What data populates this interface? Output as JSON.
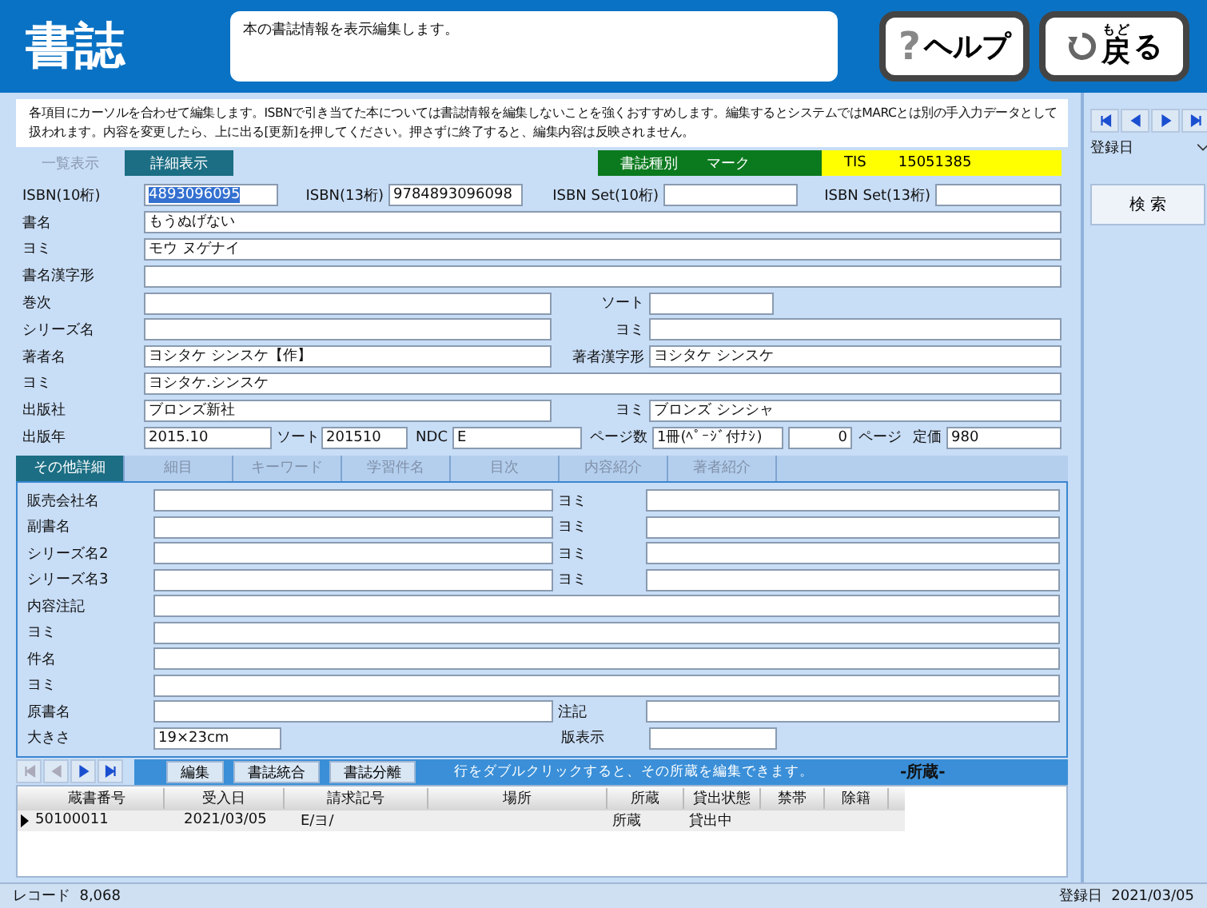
{
  "header": {
    "title": "書誌",
    "message": "本の書誌情報を表示編集します。",
    "help": {
      "icon": "?",
      "label": "ヘルプ"
    },
    "back": {
      "ruby_base": "戻",
      "ruby": "もど",
      "rest": "る"
    }
  },
  "notice": [
    "各項目にカーソルを合わせて編集します。ISBNで引き当てた本については書誌情報を編集しないことを強くおすすめします。編集するとシステムではMARCとは別の手入力データとして",
    "扱われます。内容を変更したら、上に出る[更新]を押してください。押さずに終了すると、編集内容は反映されません。"
  ],
  "view_tabs": [
    {
      "label": "一覧表示",
      "selected": false
    },
    {
      "label": "詳細表示",
      "selected": true
    }
  ],
  "badges": [
    {
      "label": "書誌種別",
      "value": "マーク",
      "color": "#0b7a1e"
    },
    {
      "label": "TIS",
      "value": "15051385",
      "color": "#ffff00"
    }
  ],
  "main_rows": [
    {
      "kind": "isbn",
      "items": [
        {
          "kind": "label",
          "text": "ISBN(10桁)"
        },
        {
          "kind": "field",
          "value": "4893096095",
          "text_selected": true
        },
        {
          "kind": "label",
          "text": "ISBN(13桁)"
        },
        {
          "kind": "field",
          "value": "9784893096098"
        },
        {
          "kind": "label",
          "text": "ISBN Set(10桁)"
        },
        {
          "kind": "field"
        },
        {
          "kind": "label",
          "text": "ISBN Set(13桁)"
        },
        {
          "kind": "field"
        }
      ]
    },
    {
      "kind": "full",
      "items": [
        {
          "kind": "label",
          "text": "書名"
        },
        {
          "kind": "field",
          "value": "もうぬげない"
        }
      ]
    },
    {
      "kind": "full",
      "items": [
        {
          "kind": "label",
          "text": "ヨミ"
        },
        {
          "kind": "field",
          "value": "モウ ヌゲナイ"
        }
      ]
    },
    {
      "kind": "full",
      "items": [
        {
          "kind": "label",
          "text": "書名漢字形"
        },
        {
          "kind": "field"
        }
      ]
    },
    {
      "kind": "splitshort",
      "items": [
        {
          "kind": "label",
          "text": "巻次"
        },
        {
          "kind": "field"
        },
        {
          "kind": "label",
          "text": "ソート"
        },
        {
          "kind": "field"
        }
      ]
    },
    {
      "kind": "split",
      "items": [
        {
          "kind": "label",
          "text": "シリーズ名"
        },
        {
          "kind": "field"
        },
        {
          "kind": "label",
          "text": "ヨミ"
        },
        {
          "kind": "field"
        }
      ]
    },
    {
      "kind": "split",
      "items": [
        {
          "kind": "label",
          "text": "著者名"
        },
        {
          "kind": "field",
          "value": "ヨシタケ シンスケ【作】"
        },
        {
          "kind": "label",
          "text": "著者漢字形"
        },
        {
          "kind": "field",
          "value": "ヨシタケ シンスケ"
        }
      ]
    },
    {
      "kind": "full",
      "items": [
        {
          "kind": "label",
          "text": "ヨミ"
        },
        {
          "kind": "field",
          "value": "ヨシタケ.シンスケ"
        }
      ]
    },
    {
      "kind": "split",
      "items": [
        {
          "kind": "label",
          "text": "出版社"
        },
        {
          "kind": "field",
          "value": "ブロンズ新社"
        },
        {
          "kind": "label",
          "text": "ヨミ"
        },
        {
          "kind": "field",
          "value": "ブロンズ シンシャ"
        }
      ]
    },
    {
      "kind": "pub",
      "items": [
        {
          "kind": "label",
          "text": "出版年"
        },
        {
          "kind": "field",
          "value": "2015.10"
        },
        {
          "kind": "label",
          "text": "ソート"
        },
        {
          "kind": "field",
          "value": "201510"
        },
        {
          "kind": "label",
          "text": "NDC"
        },
        {
          "kind": "field",
          "value": "E"
        },
        {
          "kind": "label",
          "text": "ページ数"
        },
        {
          "kind": "field",
          "value": "1冊(ﾍﾟｰｼﾞ付ﾅｼ)"
        },
        {
          "kind": "field",
          "value": "0"
        },
        {
          "kind": "label",
          "text": "ページ"
        },
        {
          "kind": "label",
          "text": "定価"
        },
        {
          "kind": "field",
          "value": "980"
        }
      ]
    }
  ],
  "sub_tabs": [
    {
      "label": "その他詳細",
      "selected": true
    },
    {
      "label": "細目",
      "selected": false
    },
    {
      "label": "キーワード",
      "selected": false
    },
    {
      "label": "学習件名",
      "selected": false
    },
    {
      "label": "目次",
      "selected": false
    },
    {
      "label": "内容紹介",
      "selected": false
    },
    {
      "label": "著者紹介",
      "selected": false
    }
  ],
  "detail_rows": [
    {
      "kind": "lsplit",
      "items": [
        {
          "kind": "label",
          "text": "販売会社名"
        },
        {
          "kind": "field"
        },
        {
          "kind": "label",
          "text": "ヨミ"
        },
        {
          "kind": "field"
        }
      ]
    },
    {
      "kind": "lsplit",
      "items": [
        {
          "kind": "label",
          "text": "副書名"
        },
        {
          "kind": "field"
        },
        {
          "kind": "label",
          "text": "ヨミ"
        },
        {
          "kind": "field"
        }
      ]
    },
    {
      "kind": "lsplit",
      "items": [
        {
          "kind": "label",
          "text": "シリーズ名2"
        },
        {
          "kind": "field"
        },
        {
          "kind": "label",
          "text": "ヨミ"
        },
        {
          "kind": "field"
        }
      ]
    },
    {
      "kind": "lsplit",
      "items": [
        {
          "kind": "label",
          "text": "シリーズ名3"
        },
        {
          "kind": "field"
        },
        {
          "kind": "label",
          "text": "ヨミ"
        },
        {
          "kind": "field"
        }
      ]
    },
    {
      "kind": "lfull",
      "items": [
        {
          "kind": "label",
          "text": "内容注記"
        },
        {
          "kind": "field"
        }
      ]
    },
    {
      "kind": "lfull",
      "items": [
        {
          "kind": "label",
          "text": "ヨミ"
        },
        {
          "kind": "field"
        }
      ]
    },
    {
      "kind": "lfull",
      "items": [
        {
          "kind": "label",
          "text": "件名"
        },
        {
          "kind": "field"
        }
      ]
    },
    {
      "kind": "lfull",
      "items": [
        {
          "kind": "label",
          "text": "ヨミ"
        },
        {
          "kind": "field"
        }
      ]
    },
    {
      "kind": "lsplit",
      "items": [
        {
          "kind": "label",
          "text": "原書名"
        },
        {
          "kind": "field"
        },
        {
          "kind": "label",
          "text": "注記"
        },
        {
          "kind": "field"
        }
      ]
    },
    {
      "kind": "lshort",
      "items": [
        {
          "kind": "label",
          "text": "大きさ"
        },
        {
          "kind": "field",
          "value": "19×23cm"
        },
        {
          "kind": "label",
          "text": "版表示"
        },
        {
          "kind": "field"
        }
      ]
    }
  ],
  "holdings": {
    "nav": [
      {
        "kind": "first",
        "disabled": true
      },
      {
        "kind": "prev",
        "disabled": true
      },
      {
        "kind": "next",
        "disabled": false
      },
      {
        "kind": "last",
        "disabled": false
      }
    ],
    "buttons": [
      "編集",
      "書誌統合",
      "書誌分離"
    ],
    "hint": "行をダブルクリックすると、その所蔵を編集できます。",
    "title": "-所蔵-",
    "columns": [
      "蔵書番号",
      "受入日",
      "請求記号",
      "場所",
      "所蔵",
      "貸出状態",
      "禁帯",
      "除籍"
    ],
    "rows": [
      {
        "current": true,
        "accession_number": "50100011",
        "received_date": "2021/03/05",
        "call_number": "E/ヨ/",
        "holding": "所蔵",
        "loan_status": "貸出中"
      }
    ]
  },
  "sidebar": {
    "nav": [
      {
        "kind": "first",
        "disabled": false
      },
      {
        "kind": "prev",
        "disabled": false
      },
      {
        "kind": "next",
        "disabled": false
      },
      {
        "kind": "last",
        "disabled": false
      }
    ],
    "sort_select": "登録日",
    "search_button": "検 索"
  },
  "status_bar": {
    "record_label": "レコード",
    "record_count": "8,068",
    "date_label": "登録日",
    "date": "2021/03/05"
  }
}
